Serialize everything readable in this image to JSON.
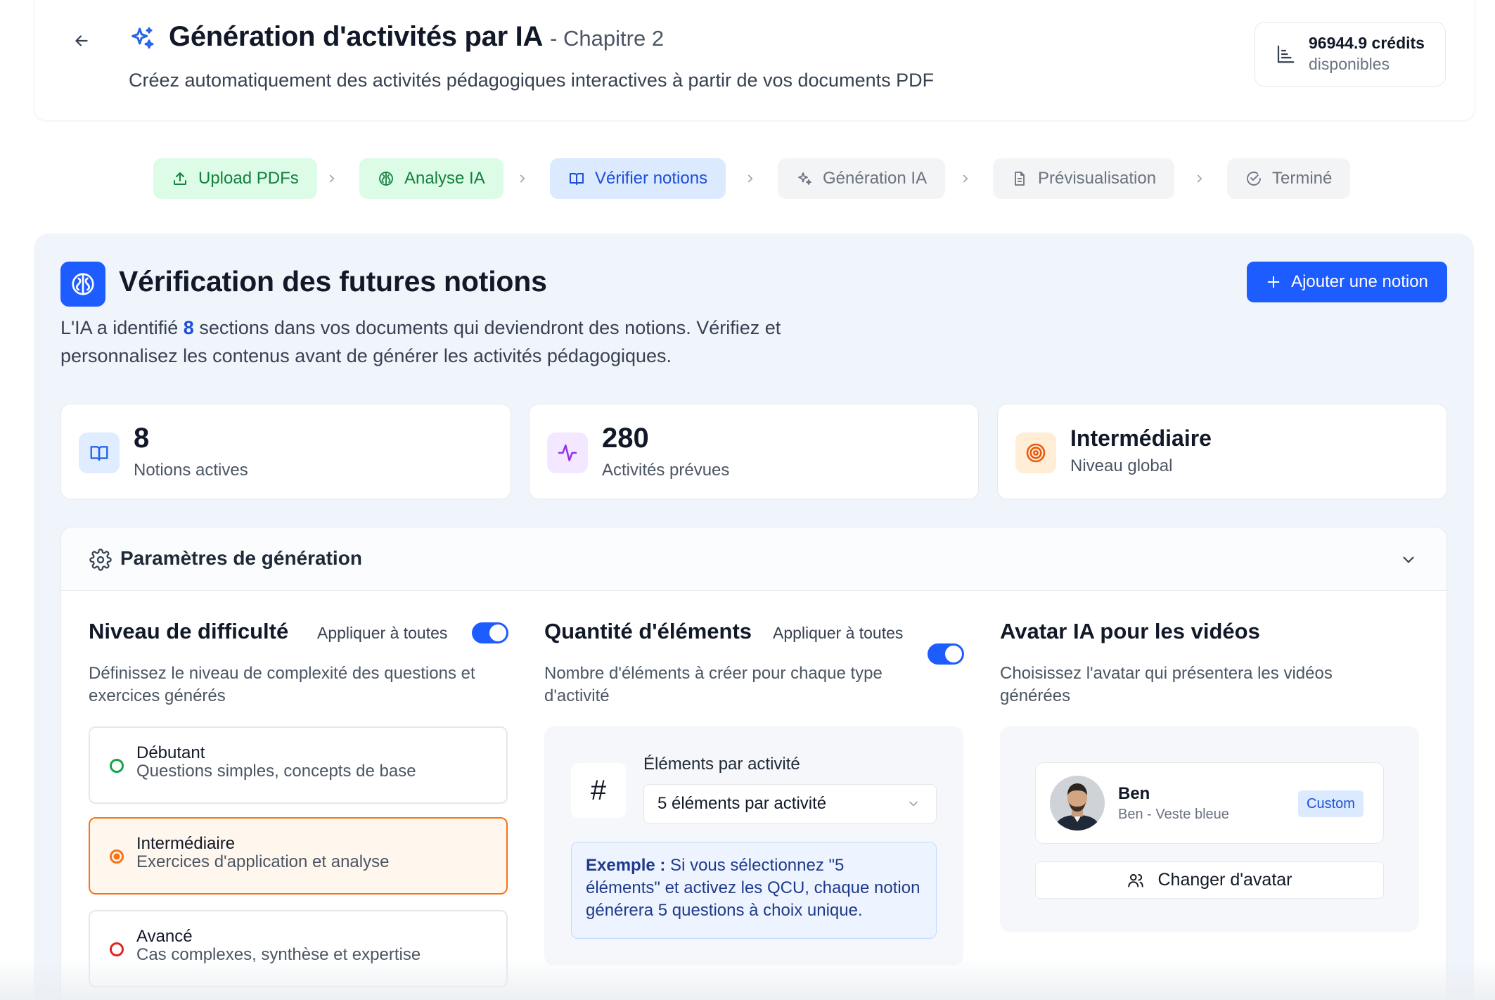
{
  "header": {
    "title": "Génération d'activités par IA",
    "chapter": "- Chapitre 2",
    "subtitle": "Créez automatiquement des activités pédagogiques interactives à partir de vos documents PDF",
    "credits_amount": "96944.9 crédits",
    "credits_label": "disponibles"
  },
  "steps": [
    {
      "label": "Upload PDFs",
      "status": "done",
      "icon": "upload-icon"
    },
    {
      "label": "Analyse IA",
      "status": "done",
      "icon": "brain-icon"
    },
    {
      "label": "Vérifier notions",
      "status": "active",
      "icon": "book-open-icon"
    },
    {
      "label": "Génération IA",
      "status": "todo",
      "icon": "sparkle-icon"
    },
    {
      "label": "Prévisualisation",
      "status": "todo",
      "icon": "document-icon"
    },
    {
      "label": "Terminé",
      "status": "todo",
      "icon": "check-circle-icon"
    }
  ],
  "section": {
    "title": "Vérification des futures notions",
    "add_button": "Ajouter une notion",
    "intro_before": "L'IA a identifié ",
    "intro_count": "8",
    "intro_after": " sections dans vos documents qui deviendront des notions. Vérifiez et personnalisez les contenus avant de générer les activités pédagogiques."
  },
  "stats": [
    {
      "value": "8",
      "label": "Notions actives",
      "icon": "book-open-icon",
      "color": "#2563eb"
    },
    {
      "value": "280",
      "label": "Activités prévues",
      "icon": "activity-icon",
      "color": "#9333ea"
    },
    {
      "value": "Intermédiaire",
      "label": "Niveau global",
      "icon": "target-icon",
      "color": "#ea580c"
    }
  ],
  "params": {
    "title": "Paramètres de génération",
    "difficulty": {
      "title": "Niveau de difficulté",
      "apply_all": "Appliquer à toutes",
      "apply_all_on": true,
      "description": "Définissez le niveau de complexité des questions et exercices générés",
      "options": [
        {
          "name": "Débutant",
          "desc": "Questions simples, concepts de base",
          "color": "#16a34a",
          "selected": false
        },
        {
          "name": "Intermédiaire",
          "desc": "Exercices d'application et analyse",
          "color": "#f97316",
          "selected": true
        },
        {
          "name": "Avancé",
          "desc": "Cas complexes, synthèse et expertise",
          "color": "#dc2626",
          "selected": false
        }
      ]
    },
    "quantity": {
      "title": "Quantité d'éléments",
      "apply_all": "Appliquer à toutes",
      "apply_all_on": true,
      "description": "Nombre d'éléments à créer pour chaque type d'activité",
      "per_activity_label": "Éléments par activité",
      "selected": "5 éléments par activité",
      "example_label": "Exemple :",
      "example_text": " Si vous sélectionnez \"5 éléments\" et activez les QCU, chaque notion générera 5 questions à choix unique."
    },
    "avatar": {
      "title": "Avatar IA pour les vidéos",
      "description": "Choisissez l'avatar qui présentera les vidéos générées",
      "name": "Ben",
      "sub": "Ben - Veste bleue",
      "badge": "Custom",
      "change_button": "Changer d'avatar"
    }
  },
  "colors": {
    "accent": "#1d5cff",
    "done_bg": "#dcfce7",
    "active_bg": "#dbeafe",
    "selected_border": "#f97316"
  }
}
